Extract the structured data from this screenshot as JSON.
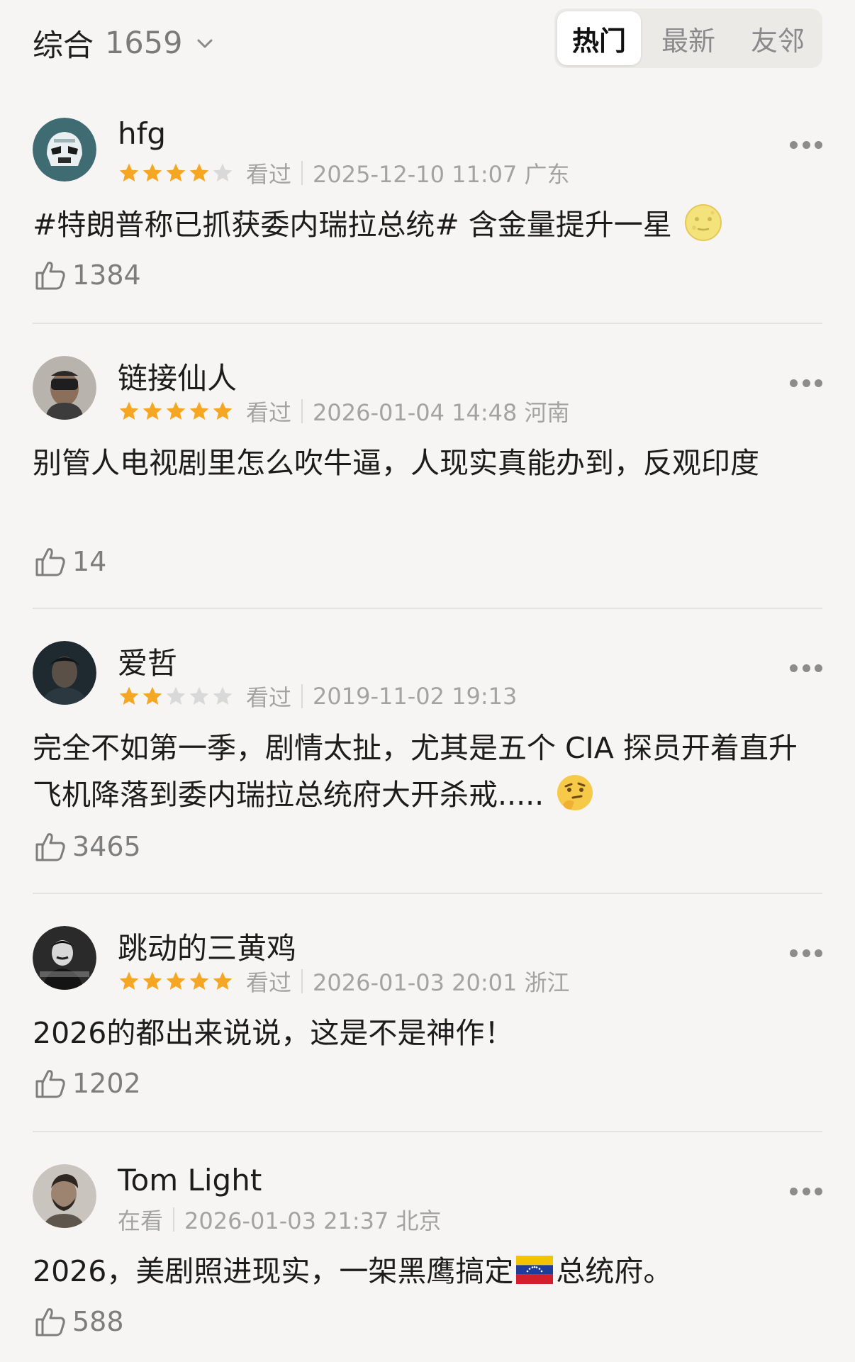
{
  "header": {
    "sort_label": "综合",
    "count": "1659",
    "tabs": [
      {
        "label": "热门",
        "active": true
      },
      {
        "label": "最新",
        "active": false
      },
      {
        "label": "友邻",
        "active": false
      }
    ]
  },
  "colors": {
    "background": "#f6f5f3",
    "star_active": "#f5a623",
    "star_inactive": "#d9d9d9",
    "meta_text": "#a3a3a3"
  },
  "comments": [
    {
      "username": "hfg",
      "rating": 4,
      "status": "看过",
      "datetime": "2025-12-10 11:07 广东",
      "text": "#特朗普称已抓获委内瑞拉总统# 含金量提升一星",
      "emoji": "moon-face-icon",
      "likes": "1384"
    },
    {
      "username": "链接仙人",
      "rating": 5,
      "status": "看过",
      "datetime": "2026-01-04 14:48 河南",
      "text": "别管人电视剧里怎么吹牛逼，人现实真能办到，反观印度",
      "emoji": "",
      "likes": "14"
    },
    {
      "username": "爱哲",
      "rating": 2,
      "status": "看过",
      "datetime": "2019-11-02 19:13",
      "text": "完全不如第一季，剧情太扯，尤其是五个 CIA 探员开着直升飞机降落到委内瑞拉总统府大开杀戒.....",
      "emoji": "thinking-face-icon",
      "likes": "3465"
    },
    {
      "username": "跳动的三黄鸡",
      "rating": 5,
      "status": "看过",
      "datetime": "2026-01-03 20:01 浙江",
      "text": "2026的都出来说说，这是不是神作！",
      "emoji": "",
      "likes": "1202"
    },
    {
      "username": "Tom Light",
      "rating": 0,
      "status": "在看",
      "datetime": "2026-01-03 21:37 北京",
      "text_before": "2026，美剧照进现实，一架黑鹰搞定",
      "text_after": "总统府。",
      "emoji": "venezuela-flag-icon",
      "likes": "588"
    }
  ]
}
